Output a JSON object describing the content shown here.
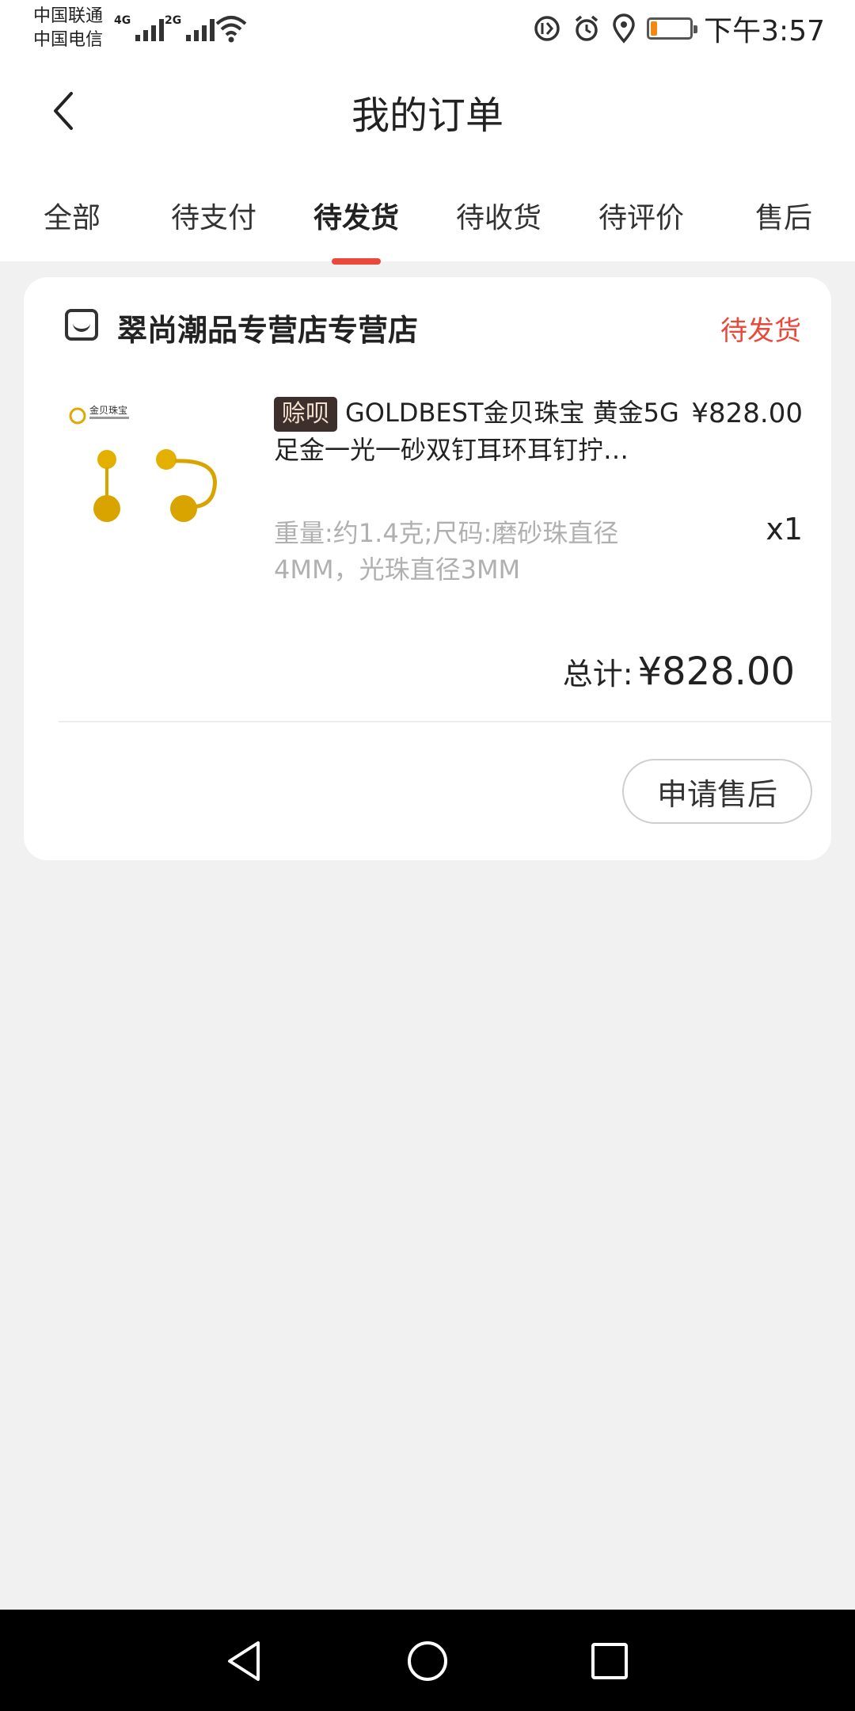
{
  "status_bar": {
    "carrier_1": "中国联通",
    "carrier_2": "中国电信",
    "net_1": "4G",
    "net_2": "2G",
    "time": "下午3:57",
    "battery_level": 0.15,
    "battery_color": "#f08a12"
  },
  "header": {
    "title": "我的订单"
  },
  "tabs": [
    {
      "label": "全部"
    },
    {
      "label": "待支付"
    },
    {
      "label": "待发货"
    },
    {
      "label": "待收货"
    },
    {
      "label": "待评价"
    },
    {
      "label": "售后"
    }
  ],
  "active_tab": "待发货",
  "order": {
    "shop_name": "翠尚潮品专营店专营店",
    "status": "待发货",
    "product": {
      "tag": "赊呗",
      "title": "GOLDBEST金贝珠宝 黄金5G足金一光一砂双钉耳环耳钉拧…",
      "price": "¥828.00",
      "spec": "重量:约1.4克;尺码:磨砂珠直径4MM，光珠直径3MM",
      "quantity": "x1",
      "brand_logo": "金贝珠宝"
    },
    "total_label": "总计:",
    "total_value": "¥828.00",
    "after_sale_button": "申请售后"
  },
  "colors": {
    "accent": "#e9483a",
    "background": "#f1f1f1"
  }
}
